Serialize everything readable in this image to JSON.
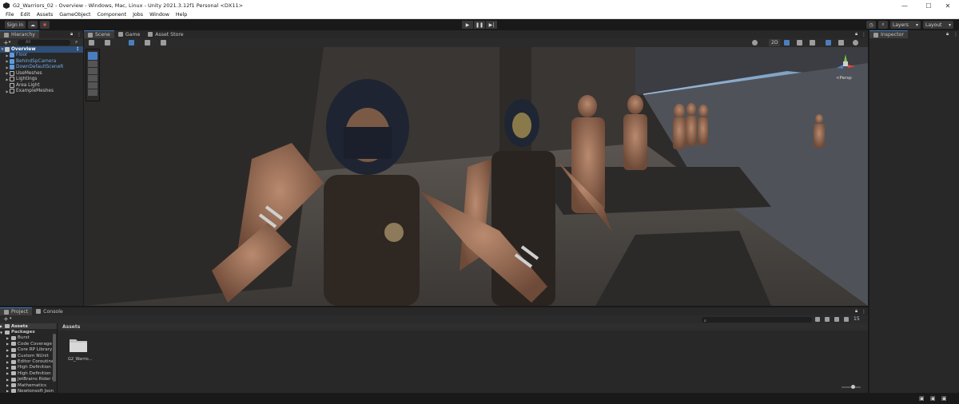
{
  "window": {
    "title": "G2_Warriors_02 - Overview - Windows, Mac, Linux - Unity 2021.3.12f1 Personal <DX11>",
    "minimize": "—",
    "maximize": "☐",
    "close": "✕"
  },
  "menu": [
    "File",
    "Edit",
    "Assets",
    "GameObject",
    "Component",
    "Jobs",
    "Window",
    "Help"
  ],
  "toolbar": {
    "signin_label": "Sign in",
    "layers_label": "Layers",
    "layout_label": "Layout"
  },
  "hierarchy": {
    "tab_label": "Hierarchy",
    "search_placeholder": "All",
    "scene_name": "Overview",
    "items": [
      {
        "label": "Floor",
        "blue": true
      },
      {
        "label": "BehindSpCamera",
        "blue": true
      },
      {
        "label": "DownDefaultSceneR",
        "blue": true
      },
      {
        "label": "UseMeshes",
        "blue": false
      },
      {
        "label": "Lightings",
        "blue": false
      },
      {
        "label": "Area Light",
        "blue": false
      },
      {
        "label": "ExampleMeshes",
        "blue": false
      }
    ]
  },
  "scene_tabs": {
    "scene": "Scene",
    "game": "Game",
    "asset_store": "Asset Store"
  },
  "scene": {
    "mode_2d": "2D",
    "persp_label": "<Persp"
  },
  "inspector": {
    "tab_label": "Inspector"
  },
  "project": {
    "tab_project": "Project",
    "tab_console": "Console",
    "breadcrumb": "Assets",
    "tree_assets": "Assets",
    "tree_packages": "Packages",
    "packages": [
      "Burst",
      "Code Coverage",
      "Core RP Library",
      "Custom NUnit",
      "Editor Coroutines",
      "High Definition R",
      "High Definition R",
      "JetBrains Rider E",
      "Mathematics",
      "Newtonsoft Json"
    ],
    "folder_label": "G2_Warrio...",
    "hidden_count": "15"
  },
  "colors": {
    "selection": "#2d4f78",
    "accent": "#3a79bb",
    "panel": "#282828"
  }
}
